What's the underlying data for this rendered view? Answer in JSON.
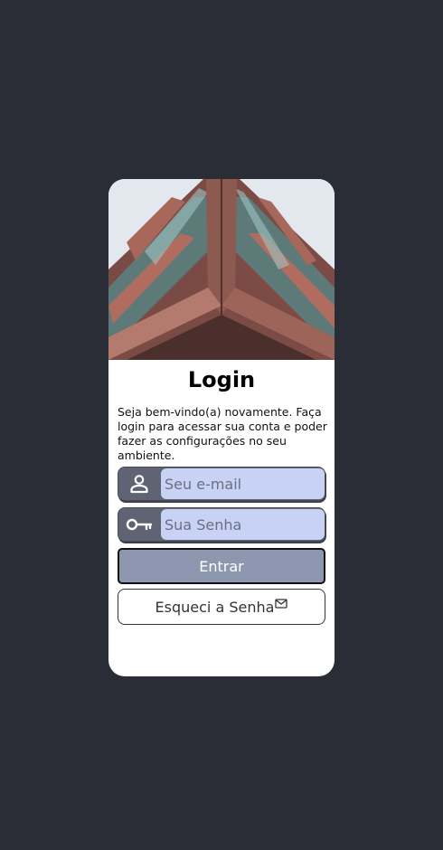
{
  "login": {
    "title": "Login",
    "intro": "Seja bem-vindo(a) novamente. Faça login para acessar sua conta e poder fazer as configurações no seu ambiente.",
    "email": {
      "placeholder": "Seu e-mail",
      "value": "",
      "icon": "user-icon"
    },
    "password": {
      "placeholder": "Sua Senha",
      "value": "",
      "icon": "key-icon"
    },
    "submit_label": "Entrar",
    "forgot_label": "Esqueci a Senha",
    "forgot_icon": "mail-icon"
  },
  "colors": {
    "background": "#2a2d35",
    "card": "#ffffff",
    "field_icon_bg": "#5f6373",
    "field_input_bg": "#c7d2f4",
    "submit_bg": "#8e97b0"
  }
}
